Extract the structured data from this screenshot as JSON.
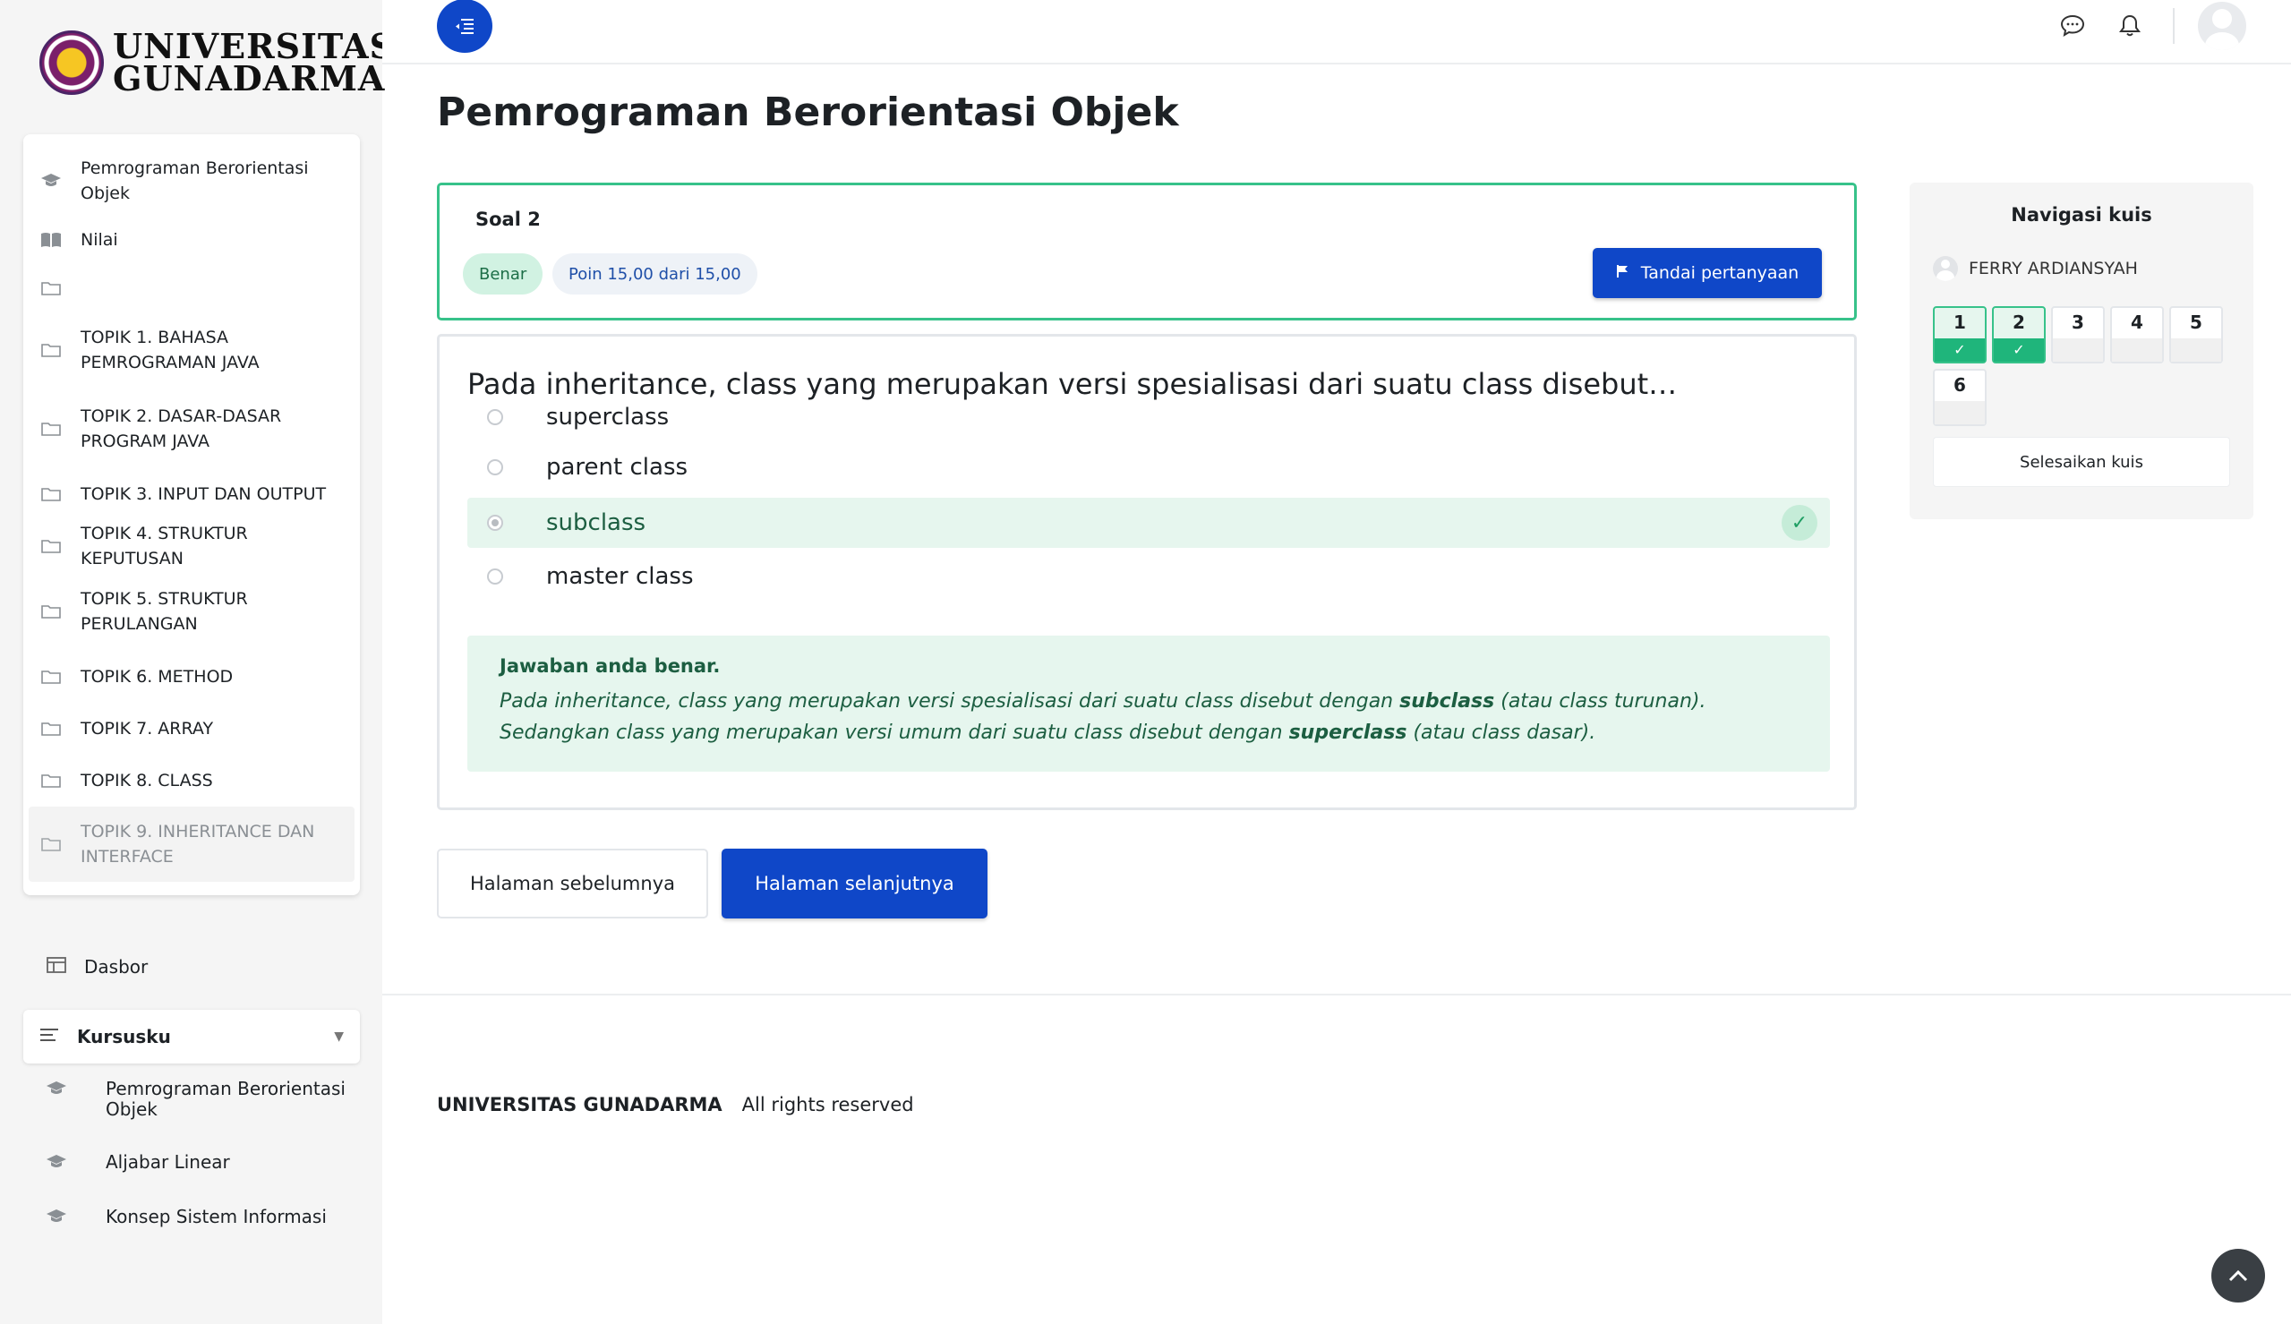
{
  "logo": {
    "line1": "UNIVERSITAS",
    "line2": "GUNADARMA"
  },
  "sidebar": {
    "course_items": [
      {
        "label": "Pemrograman Berorientasi Objek",
        "icon": "graduation-cap-icon"
      },
      {
        "label": "Nilai",
        "icon": "book-open-icon"
      },
      {
        "label": "",
        "icon": "folder-icon"
      },
      {
        "label": "TOPIK 1. BAHASA PEMROGRAMAN JAVA",
        "icon": "folder-icon"
      },
      {
        "label": "TOPIK 2. DASAR-DASAR PROGRAM JAVA",
        "icon": "folder-icon"
      },
      {
        "label": "TOPIK 3. INPUT DAN OUTPUT",
        "icon": "folder-icon"
      },
      {
        "label": "TOPIK 4. STRUKTUR KEPUTUSAN",
        "icon": "folder-icon"
      },
      {
        "label": "TOPIK 5. STRUKTUR PERULANGAN",
        "icon": "folder-icon"
      },
      {
        "label": "TOPIK 6. METHOD",
        "icon": "folder-icon"
      },
      {
        "label": "TOPIK 7. ARRAY",
        "icon": "folder-icon"
      },
      {
        "label": "TOPIK 8. CLASS",
        "icon": "folder-icon"
      },
      {
        "label": "TOPIK 9. INHERITANCE DAN INTERFACE",
        "icon": "folder-icon"
      }
    ],
    "dashboard_label": "Dasbor",
    "my_courses_label": "Kursusku",
    "my_courses": [
      {
        "label": "Pemrograman Berorientasi Objek"
      },
      {
        "label": "Aljabar Linear"
      },
      {
        "label": "Konsep Sistem Informasi"
      }
    ]
  },
  "page": {
    "title": "Pemrograman Berorientasi Objek"
  },
  "question": {
    "number_label": "Soal 2",
    "status_badge": "Benar",
    "points_badge": "Poin 15,00 dari 15,00",
    "flag_label": "Tandai pertanyaan",
    "text": "Pada inheritance, class yang merupakan versi spesialisasi dari suatu class disebut…",
    "options": [
      "superclass",
      "parent class",
      "subclass",
      "master class"
    ],
    "feedback_title": "Jawaban anda benar.",
    "feedback_part1": "Pada inheritance, class yang merupakan versi spesialisasi dari suatu class disebut dengan ",
    "feedback_bold1": "subclass",
    "feedback_part2": " (atau class turunan). Sedangkan class yang merupakan versi umum dari suatu class disebut dengan ",
    "feedback_bold2": "superclass",
    "feedback_part3": " (atau class dasar)."
  },
  "buttons": {
    "prev": "Halaman sebelumnya",
    "next": "Halaman selanjutnya"
  },
  "quiz_nav": {
    "title": "Navigasi kuis",
    "user": "FERRY ARDIANSYAH",
    "numbers": [
      "1",
      "2",
      "3",
      "4",
      "5",
      "6"
    ],
    "finish": "Selesaikan kuis"
  },
  "footer": {
    "org": "UNIVERSITAS GUNADARMA",
    "rights": "All rights reserved"
  },
  "colors": {
    "primary": "#0f47c8",
    "success": "#37c28a",
    "success_bg": "#e6f6ee"
  }
}
